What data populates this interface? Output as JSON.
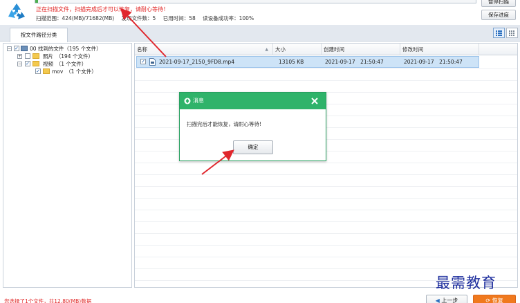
{
  "scan": {
    "status_text": "正在扫描文件，扫描完成后才可以恢复，请耐心等待！",
    "range_text": "扫描范围：424(MB)/71682(MB)",
    "found_text": "发现文件数：5",
    "elapsed_text": "已用时间：58",
    "success_rate_text": "读设备成功率：100%",
    "pause_label": "暂停扫描",
    "save_label": "保存进度",
    "progress_fraction": 0.006
  },
  "tabs": {
    "by_path": "按文件路径分类"
  },
  "tree": {
    "root": "00 找到的文件（195 个文件）",
    "photos": "照片　（194 个文件）",
    "videos": "视频　（1 个文件）",
    "mov": "mov　（1 个文件）"
  },
  "table": {
    "headers": {
      "name": "名称",
      "size": "大小",
      "created": "创建时间",
      "modified": "修改时间"
    },
    "rows": [
      {
        "name": "2021-09-17_2150_9FD8.mp4",
        "size": "13105 KB",
        "created": "2021-09-17　21:50:47",
        "modified": "2021-09-17　21:50:47"
      }
    ]
  },
  "dialog": {
    "title": "消息",
    "message": "扫描完后才能恢复，请耐心等待!",
    "ok_label": "确定"
  },
  "footer": {
    "status_text": "您选择了1个文件，共12.80(MB)数据",
    "prev_label": "上一步",
    "recover_label": "恢复"
  },
  "watermark": {
    "text": "最需教育"
  },
  "colors": {
    "accent_green": "#2fb36a",
    "recover_orange": "#f0791e",
    "warning_red": "#e02020",
    "arrow_red": "#e0262c"
  }
}
